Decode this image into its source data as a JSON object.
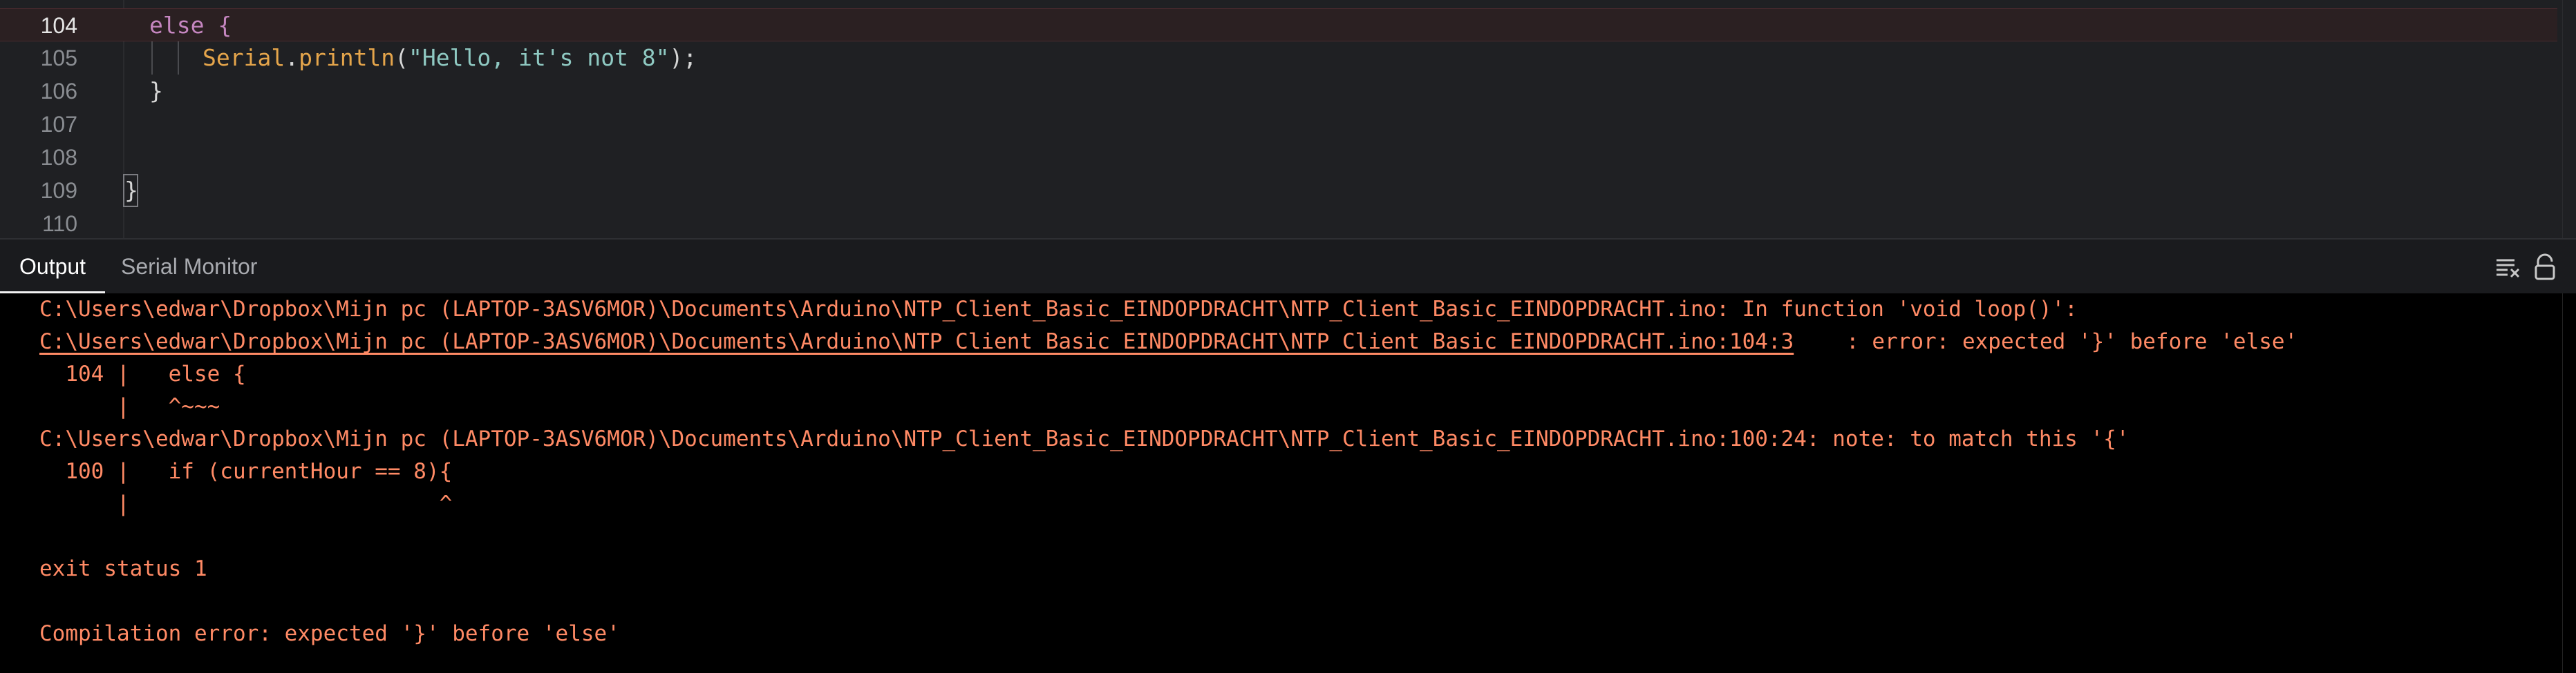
{
  "editor": {
    "lines": [
      {
        "number": "104",
        "text": "else {",
        "active": true
      },
      {
        "number": "105",
        "obj": "Serial",
        "dot": ".",
        "fn": "println",
        "open": "(",
        "str": "\"Hello, it's not 8\"",
        "close": ");"
      },
      {
        "number": "106",
        "text": "}"
      },
      {
        "number": "107",
        "text": ""
      },
      {
        "number": "108",
        "text": ""
      },
      {
        "number": "109",
        "text": "}"
      },
      {
        "number": "110",
        "text": ""
      }
    ]
  },
  "panel": {
    "tabs": [
      {
        "label": "Output",
        "active": true
      },
      {
        "label": "Serial Monitor",
        "active": false
      }
    ],
    "icons": [
      "clear-output-icon",
      "unlock-scroll-icon"
    ]
  },
  "output": {
    "lines": [
      "C:\\Users\\edwar\\Dropbox\\Mijn pc (LAPTOP-3ASV6MOR)\\Documents\\Arduino\\NTP_Client_Basic_EINDOPDRACHT\\NTP_Client_Basic_EINDOPDRACHT.ino: In function 'void loop()':",
      "C:\\Users\\edwar\\Dropbox\\Mijn pc (LAPTOP-3ASV6MOR)\\Documents\\Arduino\\NTP_Client_Basic_EINDOPDRACHT\\NTP_Client_Basic_EINDOPDRACHT.ino:104:3",
      ": error: expected '}' before 'else'",
      "  104 |   else {",
      "      |   ^~~~",
      "C:\\Users\\edwar\\Dropbox\\Mijn pc (LAPTOP-3ASV6MOR)\\Documents\\Arduino\\NTP_Client_Basic_EINDOPDRACHT\\NTP_Client_Basic_EINDOPDRACHT.ino:100:24: note: to match this '{'",
      "  100 |   if (currentHour == 8){",
      "      |                        ^",
      "",
      "exit status 1",
      "",
      "Compilation error: expected '}' before 'else'"
    ]
  },
  "colors": {
    "editor_bg": "#1f2023",
    "console_bg": "#000000",
    "error_text": "#ff8a65"
  }
}
